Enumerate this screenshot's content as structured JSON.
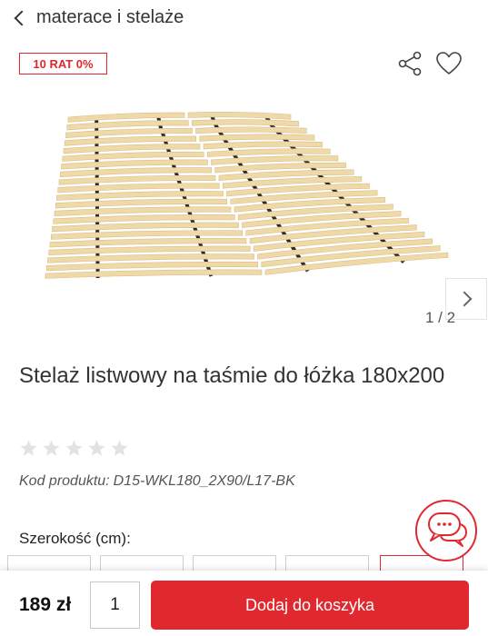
{
  "header": {
    "back_label": "materace i stelaże"
  },
  "badge": {
    "label": "10 RAT 0%"
  },
  "gallery": {
    "counter": "1 / 2",
    "image": "bed-slat-frame"
  },
  "product": {
    "title": "Stelaż listwowy na taśmie do łóżka 180x200",
    "rating_stars": 0,
    "rating_max": 5,
    "code_label": "Kod produktu:",
    "code_value": "D15-WKL180_2X90/L17-BK"
  },
  "options": {
    "label": "Szerokość (cm):"
  },
  "purchase": {
    "price": "189 zł",
    "quantity": "1",
    "add_label": "Dodaj do koszyka"
  },
  "colors": {
    "accent": "#e0282f",
    "slat": "#efd9a8",
    "strap": "#2a2a2a",
    "star": "#e2e2e2"
  },
  "icons": {
    "share": "share-icon",
    "wishlist": "heart-icon",
    "chat": "chat-icon"
  }
}
